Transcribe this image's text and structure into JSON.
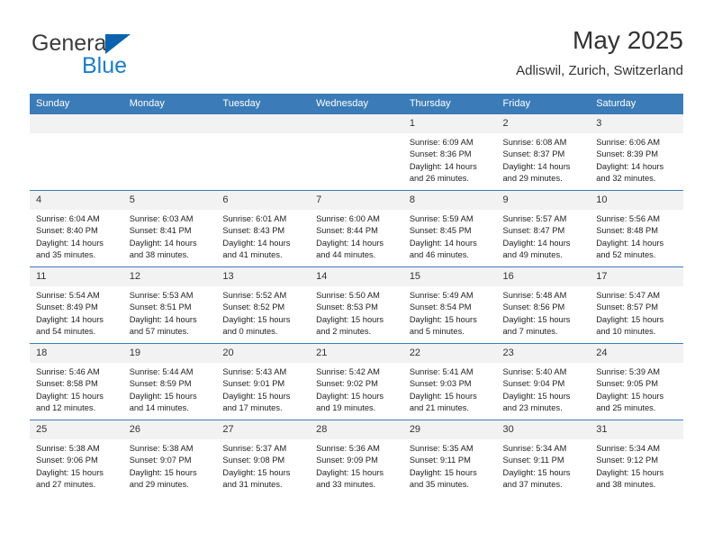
{
  "brand": {
    "name_top": "General",
    "name_bottom": "Blue",
    "triangle_color": "#0b63ad",
    "blue_color": "#1a7ec8"
  },
  "header": {
    "title": "May 2025",
    "subtitle": "Adliswil, Zurich, Switzerland"
  },
  "theme": {
    "header_bg": "#3b7cb8",
    "header_text": "#ffffff",
    "daynum_bg": "#f2f2f2",
    "row_border": "#3b7cb8"
  },
  "weekdays": [
    "Sunday",
    "Monday",
    "Tuesday",
    "Wednesday",
    "Thursday",
    "Friday",
    "Saturday"
  ],
  "weeks": [
    [
      {
        "day": "",
        "lines": []
      },
      {
        "day": "",
        "lines": []
      },
      {
        "day": "",
        "lines": []
      },
      {
        "day": "",
        "lines": []
      },
      {
        "day": "1",
        "lines": [
          "Sunrise: 6:09 AM",
          "Sunset: 8:36 PM",
          "Daylight: 14 hours",
          "and 26 minutes."
        ]
      },
      {
        "day": "2",
        "lines": [
          "Sunrise: 6:08 AM",
          "Sunset: 8:37 PM",
          "Daylight: 14 hours",
          "and 29 minutes."
        ]
      },
      {
        "day": "3",
        "lines": [
          "Sunrise: 6:06 AM",
          "Sunset: 8:39 PM",
          "Daylight: 14 hours",
          "and 32 minutes."
        ]
      }
    ],
    [
      {
        "day": "4",
        "lines": [
          "Sunrise: 6:04 AM",
          "Sunset: 8:40 PM",
          "Daylight: 14 hours",
          "and 35 minutes."
        ]
      },
      {
        "day": "5",
        "lines": [
          "Sunrise: 6:03 AM",
          "Sunset: 8:41 PM",
          "Daylight: 14 hours",
          "and 38 minutes."
        ]
      },
      {
        "day": "6",
        "lines": [
          "Sunrise: 6:01 AM",
          "Sunset: 8:43 PM",
          "Daylight: 14 hours",
          "and 41 minutes."
        ]
      },
      {
        "day": "7",
        "lines": [
          "Sunrise: 6:00 AM",
          "Sunset: 8:44 PM",
          "Daylight: 14 hours",
          "and 44 minutes."
        ]
      },
      {
        "day": "8",
        "lines": [
          "Sunrise: 5:59 AM",
          "Sunset: 8:45 PM",
          "Daylight: 14 hours",
          "and 46 minutes."
        ]
      },
      {
        "day": "9",
        "lines": [
          "Sunrise: 5:57 AM",
          "Sunset: 8:47 PM",
          "Daylight: 14 hours",
          "and 49 minutes."
        ]
      },
      {
        "day": "10",
        "lines": [
          "Sunrise: 5:56 AM",
          "Sunset: 8:48 PM",
          "Daylight: 14 hours",
          "and 52 minutes."
        ]
      }
    ],
    [
      {
        "day": "11",
        "lines": [
          "Sunrise: 5:54 AM",
          "Sunset: 8:49 PM",
          "Daylight: 14 hours",
          "and 54 minutes."
        ]
      },
      {
        "day": "12",
        "lines": [
          "Sunrise: 5:53 AM",
          "Sunset: 8:51 PM",
          "Daylight: 14 hours",
          "and 57 minutes."
        ]
      },
      {
        "day": "13",
        "lines": [
          "Sunrise: 5:52 AM",
          "Sunset: 8:52 PM",
          "Daylight: 15 hours",
          "and 0 minutes."
        ]
      },
      {
        "day": "14",
        "lines": [
          "Sunrise: 5:50 AM",
          "Sunset: 8:53 PM",
          "Daylight: 15 hours",
          "and 2 minutes."
        ]
      },
      {
        "day": "15",
        "lines": [
          "Sunrise: 5:49 AM",
          "Sunset: 8:54 PM",
          "Daylight: 15 hours",
          "and 5 minutes."
        ]
      },
      {
        "day": "16",
        "lines": [
          "Sunrise: 5:48 AM",
          "Sunset: 8:56 PM",
          "Daylight: 15 hours",
          "and 7 minutes."
        ]
      },
      {
        "day": "17",
        "lines": [
          "Sunrise: 5:47 AM",
          "Sunset: 8:57 PM",
          "Daylight: 15 hours",
          "and 10 minutes."
        ]
      }
    ],
    [
      {
        "day": "18",
        "lines": [
          "Sunrise: 5:46 AM",
          "Sunset: 8:58 PM",
          "Daylight: 15 hours",
          "and 12 minutes."
        ]
      },
      {
        "day": "19",
        "lines": [
          "Sunrise: 5:44 AM",
          "Sunset: 8:59 PM",
          "Daylight: 15 hours",
          "and 14 minutes."
        ]
      },
      {
        "day": "20",
        "lines": [
          "Sunrise: 5:43 AM",
          "Sunset: 9:01 PM",
          "Daylight: 15 hours",
          "and 17 minutes."
        ]
      },
      {
        "day": "21",
        "lines": [
          "Sunrise: 5:42 AM",
          "Sunset: 9:02 PM",
          "Daylight: 15 hours",
          "and 19 minutes."
        ]
      },
      {
        "day": "22",
        "lines": [
          "Sunrise: 5:41 AM",
          "Sunset: 9:03 PM",
          "Daylight: 15 hours",
          "and 21 minutes."
        ]
      },
      {
        "day": "23",
        "lines": [
          "Sunrise: 5:40 AM",
          "Sunset: 9:04 PM",
          "Daylight: 15 hours",
          "and 23 minutes."
        ]
      },
      {
        "day": "24",
        "lines": [
          "Sunrise: 5:39 AM",
          "Sunset: 9:05 PM",
          "Daylight: 15 hours",
          "and 25 minutes."
        ]
      }
    ],
    [
      {
        "day": "25",
        "lines": [
          "Sunrise: 5:38 AM",
          "Sunset: 9:06 PM",
          "Daylight: 15 hours",
          "and 27 minutes."
        ]
      },
      {
        "day": "26",
        "lines": [
          "Sunrise: 5:38 AM",
          "Sunset: 9:07 PM",
          "Daylight: 15 hours",
          "and 29 minutes."
        ]
      },
      {
        "day": "27",
        "lines": [
          "Sunrise: 5:37 AM",
          "Sunset: 9:08 PM",
          "Daylight: 15 hours",
          "and 31 minutes."
        ]
      },
      {
        "day": "28",
        "lines": [
          "Sunrise: 5:36 AM",
          "Sunset: 9:09 PM",
          "Daylight: 15 hours",
          "and 33 minutes."
        ]
      },
      {
        "day": "29",
        "lines": [
          "Sunrise: 5:35 AM",
          "Sunset: 9:11 PM",
          "Daylight: 15 hours",
          "and 35 minutes."
        ]
      },
      {
        "day": "30",
        "lines": [
          "Sunrise: 5:34 AM",
          "Sunset: 9:11 PM",
          "Daylight: 15 hours",
          "and 37 minutes."
        ]
      },
      {
        "day": "31",
        "lines": [
          "Sunrise: 5:34 AM",
          "Sunset: 9:12 PM",
          "Daylight: 15 hours",
          "and 38 minutes."
        ]
      }
    ]
  ]
}
